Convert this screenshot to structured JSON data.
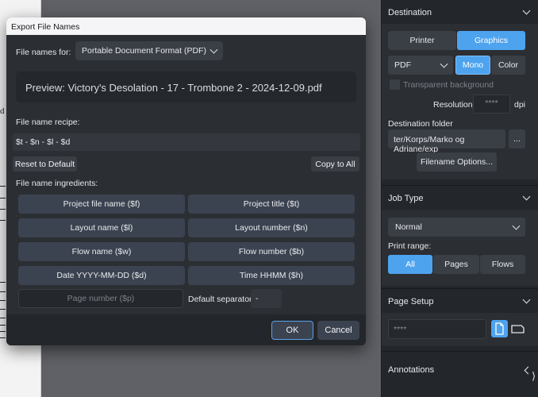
{
  "background": {
    "doc_mark": "d"
  },
  "dialog": {
    "title": "Export File Names",
    "file_names_for_label": "File names for:",
    "file_names_for_value": "Portable Document Format (PDF)",
    "preview": "Preview: Victory's Desolation - 17 - Trombone 2 - 2024-12-09.pdf",
    "recipe_label": "File name recipe:",
    "recipe_value": "$t - $n - $l - $d",
    "reset_button": "Reset to Default",
    "copy_all_button": "Copy to All",
    "ingredients_label": "File name ingredients:",
    "ingredients": [
      "Project file name ($f)",
      "Project title ($t)",
      "Layout name ($l)",
      "Layout number ($n)",
      "Flow name ($w)",
      "Flow number ($b)",
      "Date YYYY-MM-DD ($d)",
      "Time HHMM ($h)",
      "Page number ($p)"
    ],
    "separator_label": "Default separator:",
    "separator_value": "-",
    "ok_button": "OK",
    "cancel_button": "Cancel"
  },
  "panel": {
    "destination": {
      "title": "Destination",
      "printer": "Printer",
      "graphics": "Graphics",
      "format": "PDF",
      "mono": "Mono",
      "color": "Color",
      "transparent": "Transparent background",
      "resolution_label": "Resolution",
      "resolution_value": "****",
      "resolution_unit": "dpi",
      "folder_label": "Destination folder",
      "folder_value": "ter/Korps/Marko og Adriane/exp",
      "browse": "...",
      "filename_options": "Filename Options..."
    },
    "job_type": {
      "title": "Job Type",
      "value": "Normal",
      "print_range_label": "Print range:",
      "all": "All",
      "pages": "Pages",
      "flows": "Flows"
    },
    "page_setup": {
      "title": "Page Setup",
      "value": "****"
    },
    "annotations": {
      "title": "Annotations"
    },
    "edge_glyph": "⟩"
  },
  "colors": {
    "accent": "#4ea3ef",
    "panel_bg": "#23262b",
    "dialog_bg": "#2b2e33"
  }
}
